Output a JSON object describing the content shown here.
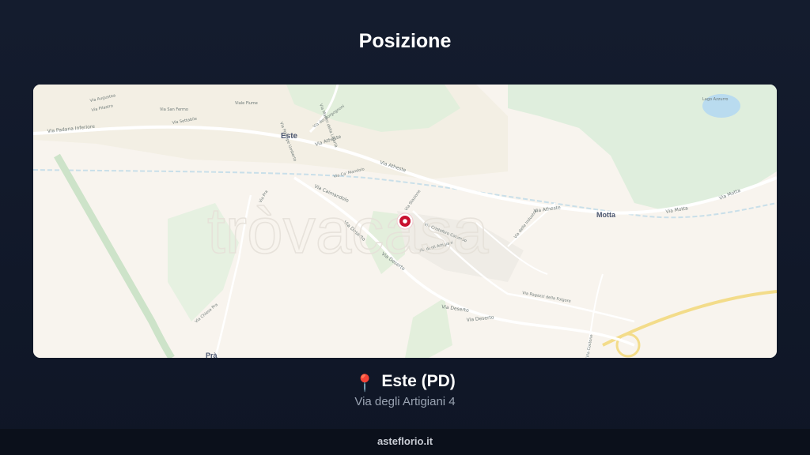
{
  "page_title": "Posizione",
  "map": {
    "watermark": "tròvacasa",
    "places": [
      {
        "name": "Este",
        "kind": "town"
      },
      {
        "name": "Motta",
        "kind": "town"
      },
      {
        "name": "Prà",
        "kind": "town"
      },
      {
        "name": "Lago Azzurro",
        "kind": "lake"
      }
    ],
    "streets": [
      "Via Padana Inferiore",
      "Via Atheste",
      "Via Atheste",
      "Via Atheste",
      "Via Motta",
      "Via Motta",
      "Via Deserto",
      "Via Deserto",
      "Via Deserto",
      "Via Deserto",
      "Via Ca' Mandolo",
      "Via Caimandolo",
      "Via Pra",
      "Via Ragazzi della Folgore",
      "Via Costone",
      "Via San Fermo",
      "Via Settabile",
      "Via Principe Umberto",
      "Via dei Borgognoni",
      "Viale Fiume",
      "Via Augustea",
      "Via Pilastro",
      "Via Chiesa Pra",
      "Via degli Artigiani",
      "Via Cristoforo Colombo",
      "Via Stazione",
      "Via delle Industrie",
      "Via Martiri della Libertà"
    ]
  },
  "location": {
    "pin_icon": "📍",
    "city": "Este (PD)",
    "address": "Via degli Artigiani 4"
  },
  "footer": {
    "site": "asteflorio.it"
  },
  "colors": {
    "background": "#111a2c",
    "map_base": "#f8f4ee",
    "park_green": "#dfeedd",
    "water": "#b9dbef",
    "motorway": "#f3dc8a",
    "marker": "#c8102e"
  }
}
